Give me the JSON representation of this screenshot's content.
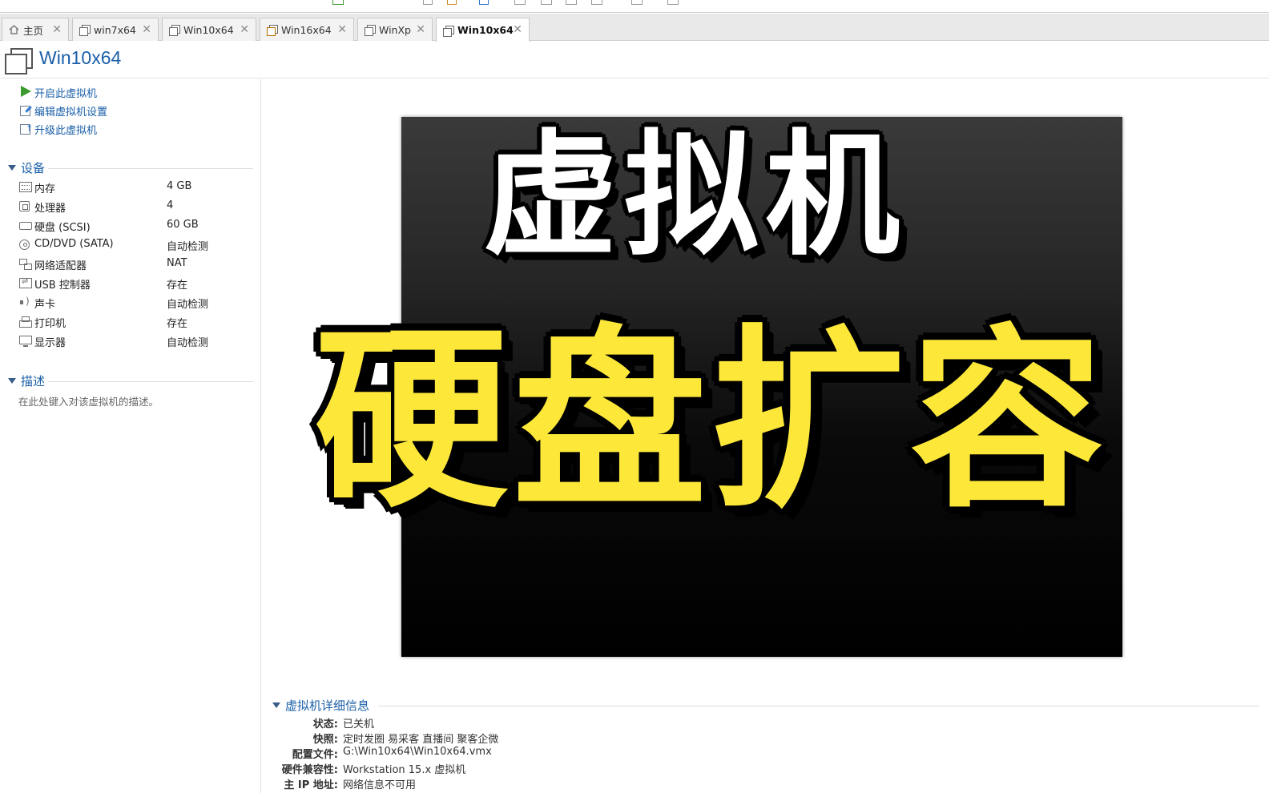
{
  "tabs": [
    {
      "label": "主页",
      "icon": "home-icon"
    },
    {
      "label": "win7x64",
      "icon": "vm-icon"
    },
    {
      "label": "Win10x64",
      "icon": "vm-icon"
    },
    {
      "label": "Win16x64",
      "icon": "vm-running-icon"
    },
    {
      "label": "WinXp",
      "icon": "vm-icon"
    },
    {
      "label": "Win10x64",
      "icon": "vm-icon",
      "active": true
    }
  ],
  "vm_title": "Win10x64",
  "actions": [
    {
      "label": "开启此虚拟机",
      "icon": "play-icon"
    },
    {
      "label": "编辑虚拟机设置",
      "icon": "edit-settings-icon"
    },
    {
      "label": "升级此虚拟机",
      "icon": "upgrade-icon"
    }
  ],
  "devices_section": "设备",
  "devices": [
    {
      "name": "内存",
      "value": "4 GB",
      "icon": "memory-icon"
    },
    {
      "name": "处理器",
      "value": "4",
      "icon": "cpu-icon"
    },
    {
      "name": "硬盘 (SCSI)",
      "value": "60 GB",
      "icon": "disk-icon"
    },
    {
      "name": "CD/DVD (SATA)",
      "value": "自动检测",
      "icon": "cd-icon"
    },
    {
      "name": "网络适配器",
      "value": "NAT",
      "icon": "network-icon"
    },
    {
      "name": "USB 控制器",
      "value": "存在",
      "icon": "usb-icon"
    },
    {
      "name": "声卡",
      "value": "自动检测",
      "icon": "sound-icon"
    },
    {
      "name": "打印机",
      "value": "存在",
      "icon": "printer-icon"
    },
    {
      "name": "显示器",
      "value": "自动检测",
      "icon": "display-icon"
    }
  ],
  "description_section": "描述",
  "description_placeholder": "在此处键入对该虚拟机的描述。",
  "cover": {
    "line1": "虚拟机",
    "line2": "硬盘扩容",
    "line1_color": "#ffffff",
    "line2_color": "#fde83a"
  },
  "details_section": "虚拟机详细信息",
  "details": [
    {
      "label": "状态:",
      "value": "已关机"
    },
    {
      "label": "快照:",
      "value": "定时发圈 易采客  直播间 聚客企微"
    },
    {
      "label": "配置文件:",
      "value": "G:\\Win10x64\\Win10x64.vmx"
    },
    {
      "label": "硬件兼容性:",
      "value": "Workstation 15.x 虚拟机"
    },
    {
      "label": "主 IP 地址:",
      "value": "网络信息不可用"
    }
  ]
}
